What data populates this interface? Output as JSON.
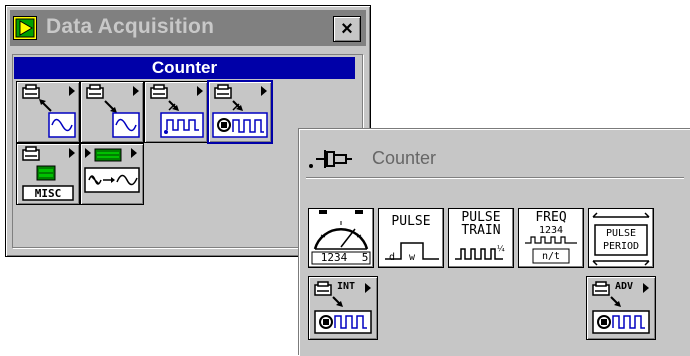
{
  "daq_palette": {
    "title": "Data Acquisition",
    "close_label": "×",
    "header": "Counter",
    "tiles": [
      {
        "name": "analog-input-icon"
      },
      {
        "name": "analog-output-icon"
      },
      {
        "name": "digital-io-icon"
      },
      {
        "name": "counter-icon"
      },
      {
        "name": "calibration-config-icon",
        "label": "MISC"
      },
      {
        "name": "signal-conditioning-icon"
      }
    ]
  },
  "counter_palette": {
    "title": "Counter",
    "vis": [
      {
        "name": "event-counter-vi",
        "digits": "1234",
        "digit_last": "5"
      },
      {
        "name": "pulse-generator-vi",
        "label": "PULSE",
        "d": "d",
        "w": "w"
      },
      {
        "name": "pulse-train-vi",
        "label": "PULSE",
        "label2": "TRAIN"
      },
      {
        "name": "frequency-vi",
        "label": "FREQ",
        "digits": "1234",
        "unit": "n/t"
      },
      {
        "name": "pulse-period-vi",
        "label": "PULSE",
        "label2": "PERIOD"
      }
    ],
    "intermediate_label": "INT",
    "advanced_label": "ADV"
  }
}
